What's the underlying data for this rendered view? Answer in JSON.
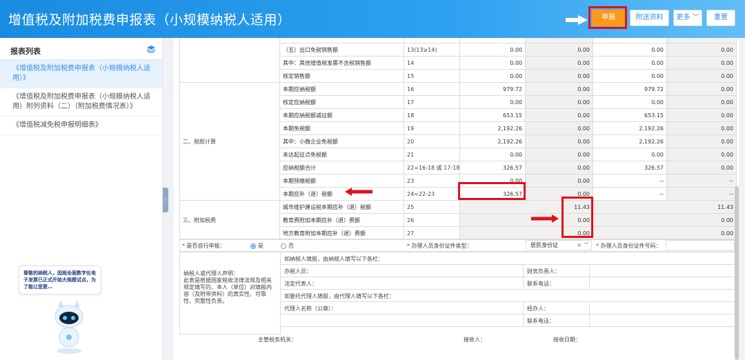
{
  "header": {
    "title": "增值税及附加税费申报表（小规模纳税人适用）",
    "buttons": {
      "submit": "申报",
      "attach": "附送资料",
      "more": "更多",
      "reset": "重置"
    }
  },
  "sidebar": {
    "title": "报表列表",
    "items": [
      {
        "label": "《增值税及附加税费申报表（小规模纳税人适用）》",
        "active": true
      },
      {
        "label": "《增值税及附加税费申报表（小规模纳税人适用）附列资料（二）（附加税费情况表）》",
        "active": false
      },
      {
        "label": "《增值税减免税申报明细表》",
        "active": false
      }
    ],
    "notice": "尊敬的纳税人，因规全面数字化电子发票已正式开始大规模试点，为了能让您更…"
  },
  "table": {
    "rows": [
      {
        "section": "",
        "item": "",
        "code": "",
        "c1": "",
        "c2": "",
        "c3": "",
        "c4": ""
      },
      {
        "section": "",
        "item": "（五）出口免税销售额",
        "code": "13(13≥14)",
        "c1": "0.00",
        "c2": "0.00",
        "c3": "0.00",
        "c4": "0.00"
      },
      {
        "section": "",
        "item": "其中：其他增值税发票不含税销售额",
        "code": "14",
        "c1": "0.00",
        "c2": "0.00",
        "c3": "0.00",
        "c4": "0.00"
      },
      {
        "section": "",
        "item": "核定销售额",
        "code": "15",
        "c1": "0.00",
        "c2": "0.00",
        "c3": "0.00",
        "c4": "0.00"
      },
      {
        "section": "",
        "item": "本期应纳税额",
        "code": "16",
        "c1": "979.72",
        "c2": "0.00",
        "c3": "979.72",
        "c4": "0.00"
      },
      {
        "section": "",
        "item": "核定应纳税额",
        "code": "17",
        "c1": "0.00",
        "c2": "0.00",
        "c3": "0.00",
        "c4": "0.00"
      },
      {
        "section": "",
        "item": "本期应纳税额减征额",
        "code": "18",
        "c1": "653.15",
        "c2": "0.00",
        "c3": "653.15",
        "c4": "0.00"
      },
      {
        "section": "",
        "item": "本期免税额",
        "code": "19",
        "c1": "2,192.26",
        "c2": "0.00",
        "c3": "2,192.26",
        "c4": "0.00"
      },
      {
        "section": "二、税款计算",
        "item": "其中：小微企业免税额",
        "code": "20",
        "c1": "2,192.26",
        "c2": "0.00",
        "c3": "2,192.26",
        "c4": "0.00"
      },
      {
        "section": "",
        "item": "未达起征点免税额",
        "code": "21",
        "c1": "0.00",
        "c2": "0.00",
        "c3": "0.00",
        "c4": "0.00"
      },
      {
        "section": "",
        "item": "应纳税额合计",
        "code": "22=16-18 或 17-18",
        "c1": "326.57",
        "c2": "0.00",
        "c3": "326.57",
        "c4": "0.00"
      },
      {
        "section": "",
        "item": "本期预缴税额",
        "code": "23",
        "c1": "0.00",
        "c2": "0.00",
        "c3": "--",
        "c4": "--"
      },
      {
        "section": "",
        "item": "本期应补（退）税额",
        "code": "24=22-23",
        "c1": "326.57",
        "c2": "0.00",
        "c3": "--",
        "c4": "--"
      }
    ],
    "surcharge_section": "三、附加税费",
    "surcharge_rows": [
      {
        "item": "城市维护建设税本期应补（退）税额",
        "code": "25",
        "v1": "11.43",
        "v2": "11.43"
      },
      {
        "item": "教育费附加本期应补（退）费额",
        "code": "26",
        "v1": "0.00",
        "v2": "0.00"
      },
      {
        "item": "地方教育附加本期应补（退）费额",
        "code": "27",
        "v1": "0.00",
        "v2": "0.00"
      }
    ]
  },
  "form": {
    "self_declare_label": "是否自行申报：",
    "yes": "是",
    "no": "否",
    "agent_id_type_label": "办理人员身份证件类型：",
    "agent_id_type_value": "居民身份证",
    "agent_id_no_label": "办理人员身份证件号码：",
    "declaration_title": "纳税人或代理人声明：",
    "declaration_text": "此表是根据国家税收法律法规及相关规定填写的，本人（单位）对填报内容（及附带资料）的真实性、可靠性、完整性负责。",
    "taxpayer_fill": "如纳税人填报，由纳税人填写以下各栏：",
    "tax_handler": "办税人员：",
    "finance_head": "财务负责人：",
    "legal_rep": "法定代表人：",
    "phone": "联系电话：",
    "agent_fill": "如委托代理人填报，由代理人填写以下各栏：",
    "agent_name": "代理人名称（公章）：",
    "handler": "经办人：",
    "phone2": "联系电话：",
    "tax_authority": "主管税务机关：",
    "receiver": "接收人：",
    "receive_date": "接收日期："
  }
}
